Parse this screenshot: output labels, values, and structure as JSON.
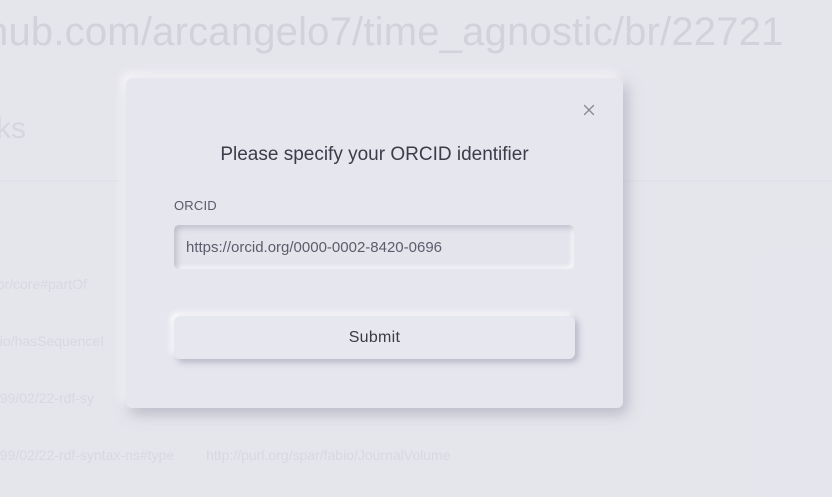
{
  "background": {
    "url_text": "hub.com/arcangelo7/time_agnostic/br/22721",
    "heading": "ks",
    "rows": [
      {
        "predicate": "rbr/core#partOf",
        "object": ""
      },
      {
        "predicate": "bio/hasSequenceI",
        "object": ""
      },
      {
        "predicate": "999/02/22-rdf-sy",
        "object": ""
      },
      {
        "predicate": "999/02/22-rdf-syntax-ns#type",
        "object": "http://purl.org/spar/fabio/JournalVolume"
      }
    ]
  },
  "modal": {
    "title": "Please specify your ORCID identifier",
    "field_label": "ORCID",
    "input_value": "https://orcid.org/0000-0002-8420-0696",
    "submit_label": "Submit",
    "close_icon": "close-icon"
  },
  "colors": {
    "background": "#e7e7ef",
    "text": "#3c3c4a"
  }
}
